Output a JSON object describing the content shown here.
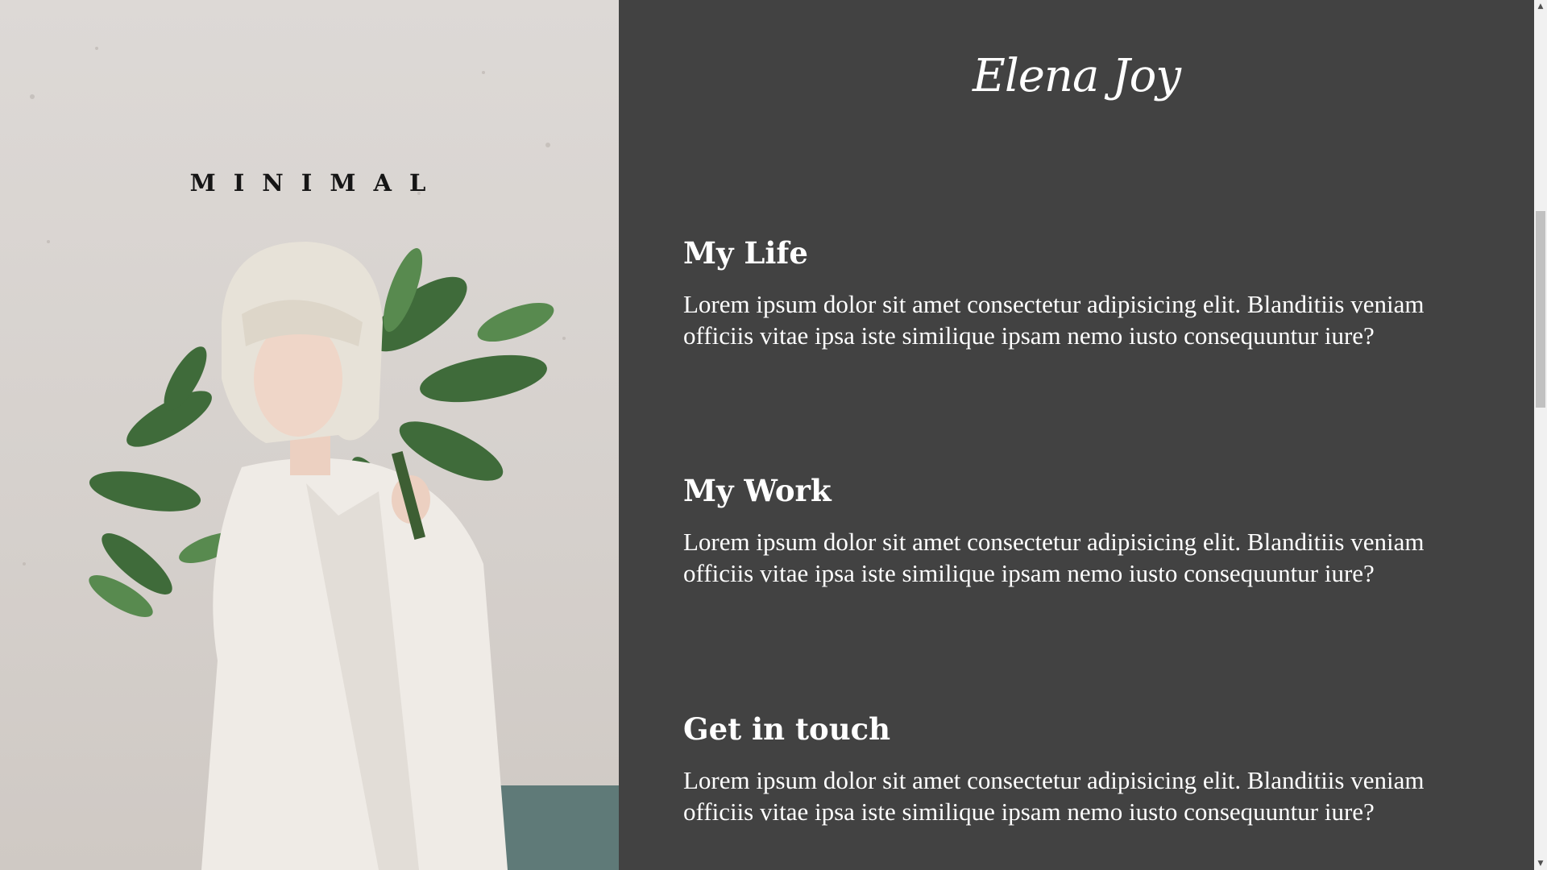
{
  "hero": {
    "title": "MINIMAL",
    "image": "woman-with-leaves-photo"
  },
  "header": {
    "signature": "Elena Joy"
  },
  "sections": [
    {
      "heading": "My Life",
      "body": "Lorem ipsum dolor sit amet consectetur adipisicing elit. Blanditiis veniam officiis vitae ipsa iste similique ipsam nemo iusto consequuntur iure?"
    },
    {
      "heading": "My Work",
      "body": "Lorem ipsum dolor sit amet consectetur adipisicing elit. Blanditiis veniam officiis vitae ipsa iste similique ipsam nemo iusto consequuntur iure?"
    },
    {
      "heading": "Get in touch",
      "body": "Lorem ipsum dolor sit amet consectetur adipisicing elit. Blanditiis veniam officiis vitae ipsa iste similique ipsam nemo iusto consequuntur iure?"
    }
  ],
  "colors": {
    "panel_background": "#424242",
    "text": "#ffffff",
    "hero_wall": "#d6d1cd"
  },
  "scrollbar": {
    "up_icon": "triangle-up-icon",
    "down_icon": "triangle-down-icon"
  }
}
